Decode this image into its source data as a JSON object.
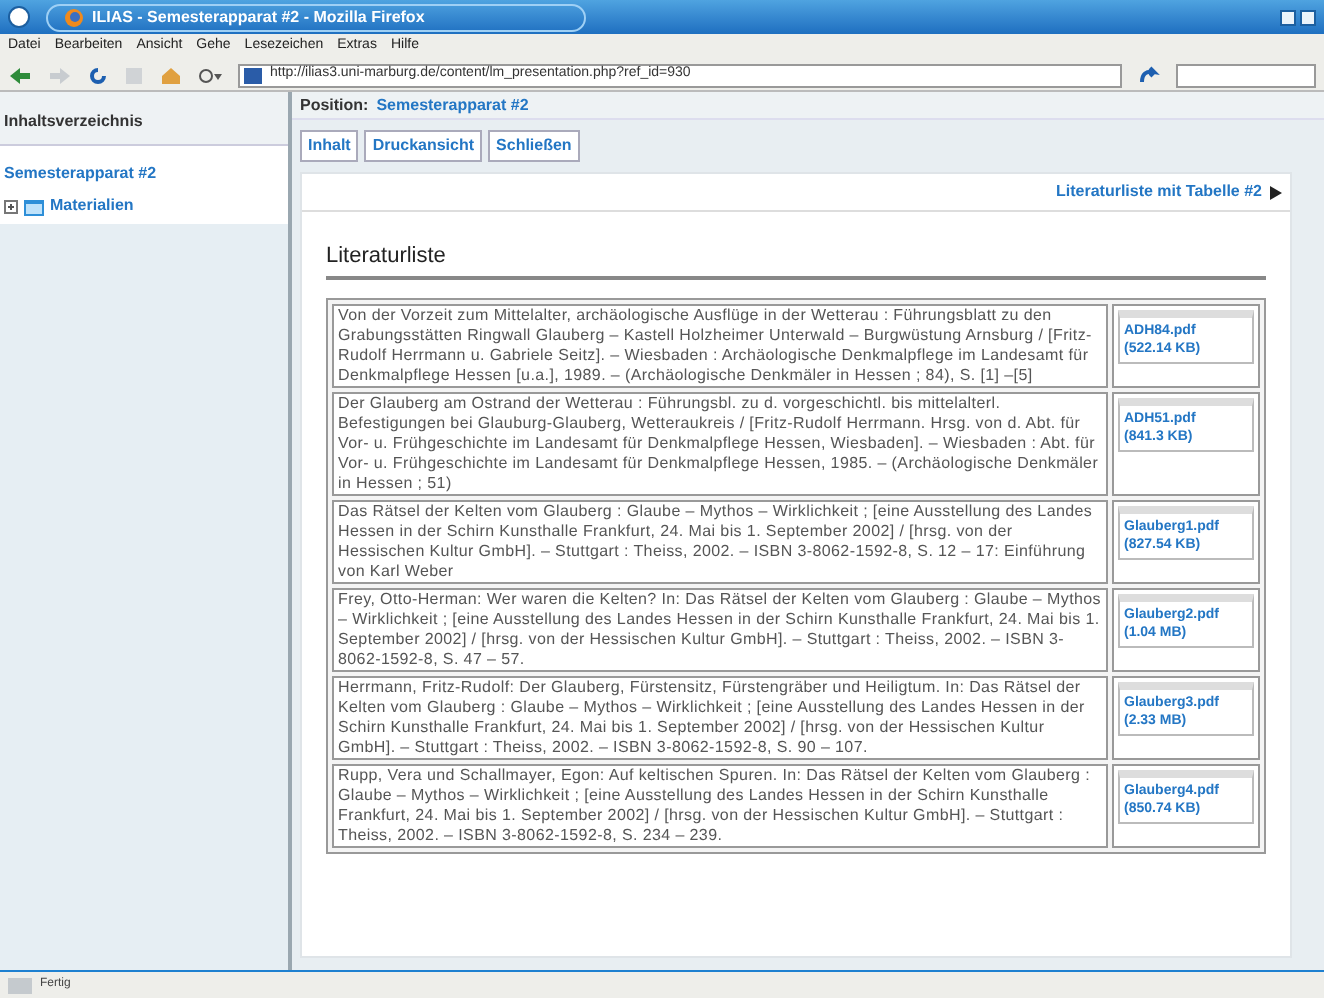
{
  "window": {
    "title": "ILIAS - Semesterapparat #2 - Mozilla Firefox"
  },
  "menu": [
    "Datei",
    "Bearbeiten",
    "Ansicht",
    "Gehe",
    "Lesezeichen",
    "Extras",
    "Hilfe"
  ],
  "address": {
    "url": "http://ilias3.uni-marburg.de/content/lm_presentation.php?ref_id=930"
  },
  "sidebar": {
    "title": "Inhaltsverzeichnis",
    "link": "Semesterapparat #2",
    "items": [
      {
        "label": "Materialien",
        "expanded": false
      }
    ]
  },
  "position": {
    "label": "Position:",
    "value": "Semesterapparat #2"
  },
  "buttons": [
    "Inhalt",
    "Druckansicht",
    "Schließen"
  ],
  "page": {
    "nav_link": "Literaturliste mit Tabelle #2",
    "heading": "Literaturliste",
    "rows": [
      {
        "citation": "Von der Vorzeit zum Mittelalter, archäologische Ausflüge in der Wetterau : Führungsblatt zu den Grabungsstätten Ringwall Glauberg – Kastell Holzheimer Unterwald – Burgwüstung Arnsburg / [Fritz-Rudolf Herrmann u. Gabriele Seitz]. – Wiesbaden : Archäologische Denkmalpflege im Landesamt für Denkmalpflege Hessen [u.a.], 1989. – (Archäologische Denkmäler in Hessen ; 84), S. [1] –[5]",
        "file": "ADH84.pdf",
        "size": "(522.14 KB)"
      },
      {
        "citation": "Der Glauberg am Ostrand der Wetterau : Führungsbl. zu d. vorgeschichtl. bis mittelalterl. Befestigungen bei Glauburg-Glauberg, Wetteraukreis / [Fritz-Rudolf Herrmann. Hrsg. von d. Abt. für Vor- u. Frühgeschichte im Landesamt für Denkmalpflege Hessen, Wiesbaden]. – Wiesbaden : Abt. für Vor- u. Frühgeschichte im Landesamt für Denkmalpflege Hessen, 1985. – (Archäologische Denkmäler in Hessen ; 51)",
        "file": "ADH51.pdf",
        "size": "(841.3 KB)"
      },
      {
        "citation": "Das Rätsel der Kelten vom Glauberg : Glaube – Mythos – Wirklichkeit ; [eine Ausstellung des Landes Hessen in der Schirn Kunsthalle Frankfurt, 24. Mai bis 1. September 2002] / [hrsg. von der Hessischen Kultur GmbH]. – Stuttgart : Theiss, 2002. – ISBN 3-8062-1592-8, S. 12 – 17: Einführung von Karl Weber",
        "file": "Glauberg1.pdf",
        "size": "(827.54 KB)"
      },
      {
        "citation": "Frey, Otto-Herman: Wer waren die Kelten? In: Das Rätsel der Kelten vom Glauberg : Glaube – Mythos – Wirklichkeit ; [eine Ausstellung des Landes Hessen in der Schirn Kunsthalle Frankfurt, 24. Mai bis 1. September 2002] / [hrsg. von der Hessischen Kultur GmbH]. – Stuttgart : Theiss, 2002. – ISBN 3-8062-1592-8, S. 47 – 57.",
        "file": "Glauberg2.pdf",
        "size": "(1.04 MB)"
      },
      {
        "citation": "Herrmann, Fritz-Rudolf: Der Glauberg, Fürstensitz, Fürstengräber und Heiligtum. In: Das Rätsel der Kelten vom Glauberg : Glaube – Mythos – Wirklichkeit ; [eine Ausstellung des Landes Hessen in der Schirn Kunsthalle Frankfurt, 24. Mai bis 1. September 2002] / [hrsg. von der Hessischen Kultur GmbH]. – Stuttgart : Theiss, 2002. – ISBN 3-8062-1592-8, S. 90 – 107.",
        "file": "Glauberg3.pdf",
        "size": "(2.33 MB)"
      },
      {
        "citation": "Rupp, Vera und Schallmayer, Egon: Auf keltischen Spuren. In: Das Rätsel der Kelten vom Glauberg : Glaube – Mythos – Wirklichkeit ; [eine Ausstellung des Landes Hessen in der Schirn Kunsthalle Frankfurt, 24. Mai bis 1. September 2002] / [hrsg. von der Hessischen Kultur GmbH]. – Stuttgart : Theiss, 2002. – ISBN 3-8062-1592-8, S. 234 – 239.",
        "file": "Glauberg4.pdf",
        "size": "(850.74 KB)"
      }
    ]
  },
  "status_bar": "Fertig"
}
